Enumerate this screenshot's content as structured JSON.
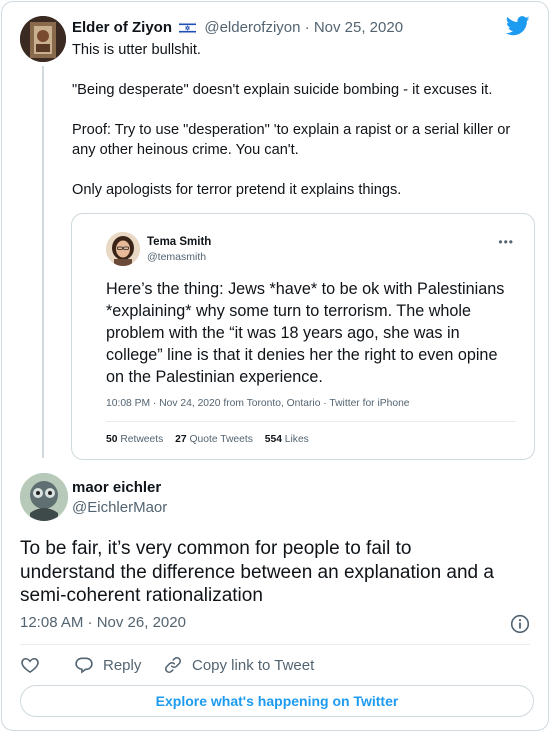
{
  "parent_tweet": {
    "display_name": "Elder of Ziyon",
    "flag_icon": "israel-flag-icon",
    "handle": "@elderofziyon",
    "separator": "·",
    "date": "Nov 25, 2020",
    "paragraphs": [
      "This is utter bullshit.",
      "\"Being desperate\" doesn't explain suicide bombing - it excuses it.",
      "Proof: Try to use \"desperation\" 'to explain a rapist or a serial killer or any other heinous crime. You can't.",
      "Only apologists for terror pretend it explains things."
    ],
    "proof_line_1": "Proof: Try to use \"desperation\" 'to explain a rapist or a serial killer or",
    "proof_line_2": "any other heinous crime. You can't."
  },
  "quoted_tweet": {
    "display_name": "Tema Smith",
    "handle": "@temasmith",
    "more_icon": "more-dots-icon",
    "lines": [
      "Here’s the thing: Jews *have* to be ok with Palestinians",
      "*explaining* why some turn to terrorism. The whole",
      "problem with the “it was 18 years ago, she was in",
      "college” line is that it denies her the right to even opine",
      "on the Palestinian experience."
    ],
    "meta": "10:08 PM · Nov 24, 2020 from Toronto, Ontario · Twitter for iPhone",
    "retweets_count": "50",
    "retweets_label": "Retweets",
    "quote_tweets_count": "27",
    "quote_tweets_label": "Quote Tweets",
    "likes_count": "554",
    "likes_label": "Likes"
  },
  "main_tweet": {
    "display_name": "maor eichler",
    "handle": "@EichlerMaor",
    "lines": [
      "To be fair, it’s very common for people to fail to",
      "understand the difference between an explanation and a",
      "semi-coherent rationalization"
    ],
    "timestamp": "12:08 AM · Nov 26, 2020"
  },
  "actions": {
    "reply_label": "Reply",
    "copy_link_label": "Copy link to Tweet"
  },
  "explore_label": "Explore what's happening on Twitter",
  "colors": {
    "brand": "#1d9bf0",
    "text": "#0f1419",
    "muted": "#536471",
    "border": "#cfd9de"
  }
}
